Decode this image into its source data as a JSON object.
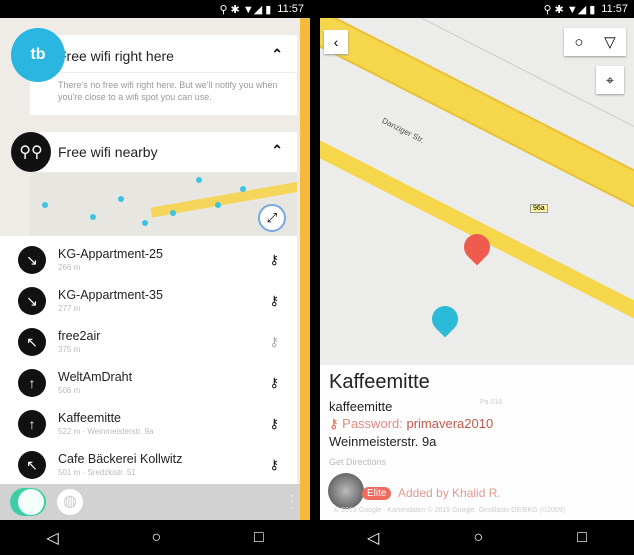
{
  "status": {
    "time": "11:57"
  },
  "left": {
    "here": {
      "title": "Free wifi right here",
      "message": "There's no free wifi right here. But we'll notify you when you're close to a wifi spot you can use.",
      "logo": "tb"
    },
    "nearby": {
      "title": "Free wifi nearby"
    },
    "items": [
      {
        "name": "KG-Appartment-25",
        "sub": "266 m",
        "arrow": "↘",
        "key": "filled"
      },
      {
        "name": "KG-Appartment-35",
        "sub": "277 m",
        "arrow": "↘",
        "key": "filled"
      },
      {
        "name": "free2air",
        "sub": "375 m",
        "arrow": "↖",
        "key": "outline"
      },
      {
        "name": "WeltAmDraht",
        "sub": "506 m",
        "arrow": "↑",
        "key": "filled"
      },
      {
        "name": "Kaffeemitte",
        "sub": "522 m · Weinmeisterstr. 9a",
        "arrow": "↑",
        "key": "filled"
      },
      {
        "name": "Cafe Bäckerei Kollwitz",
        "sub": "501 m · Sredzkistr. 51",
        "arrow": "↖",
        "key": "filled"
      }
    ]
  },
  "right": {
    "street": "Danziger Str.",
    "road_badge": "96a",
    "map_label": "Pa 018",
    "title": "Kaffeemitte",
    "ssid": "kaffeemitte",
    "password_label": "Password:",
    "password": "primavera2010",
    "address": "Weinmeisterstr. 9a",
    "directions": "Get Directions",
    "badge": "Elite",
    "added_by": "Added by Khalid R.",
    "copyright": "© 2015 Google · Kartendaten © 2015 Google, GeoBasis-DE/BKG (©2009)"
  },
  "colors": {
    "accent": "#f5b93c",
    "blue": "#29b6e0",
    "red": "#ef5b4c",
    "toggle": "#3ccfa6"
  }
}
